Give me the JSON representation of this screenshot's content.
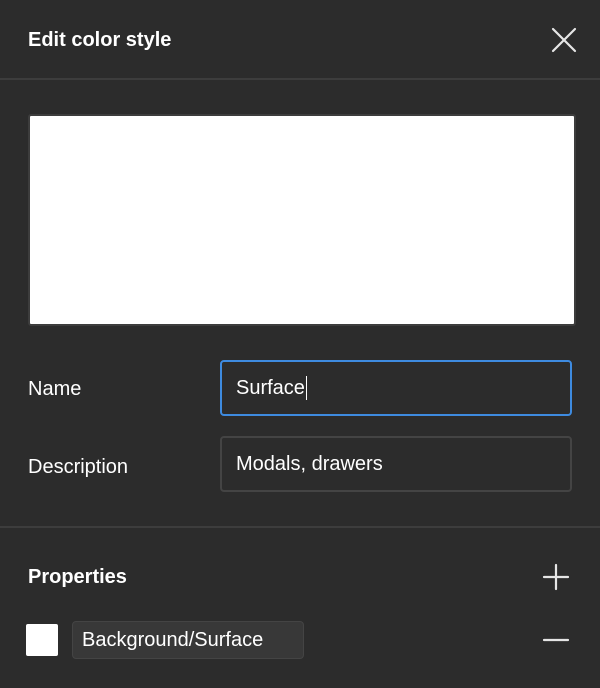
{
  "dialog": {
    "title": "Edit color style",
    "preview_color": "#FFFFFF"
  },
  "form": {
    "name_label": "Name",
    "name_value": "Surface",
    "description_label": "Description",
    "description_value": "Modals, drawers"
  },
  "properties": {
    "title": "Properties",
    "items": [
      {
        "swatch_color": "#FFFFFF",
        "label": "Background/Surface"
      }
    ]
  },
  "icons": {
    "close": "close-icon",
    "add": "plus-icon",
    "remove": "minus-icon"
  },
  "colors": {
    "background": "#2C2C2C",
    "divider": "#3D3D3D",
    "focus_accent": "#3E8BE0"
  }
}
